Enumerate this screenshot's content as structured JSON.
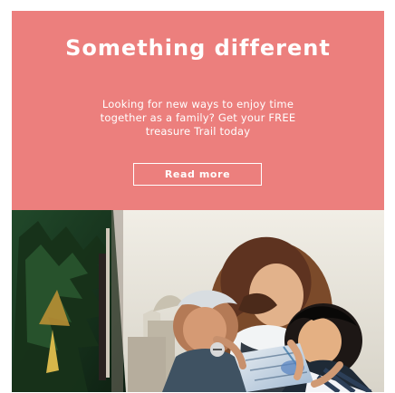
{
  "promo": {
    "title": "Something different",
    "body_lines": [
      "Looking for new ways to enjoy time",
      "together as a family? Get your FREE",
      "treasure Trail today"
    ],
    "button_label": "Read more"
  },
  "colors": {
    "promo_background": "#ec7f7d",
    "promo_text": "#ffffff"
  },
  "photo": {
    "description_icon": "family-reading-photo"
  }
}
